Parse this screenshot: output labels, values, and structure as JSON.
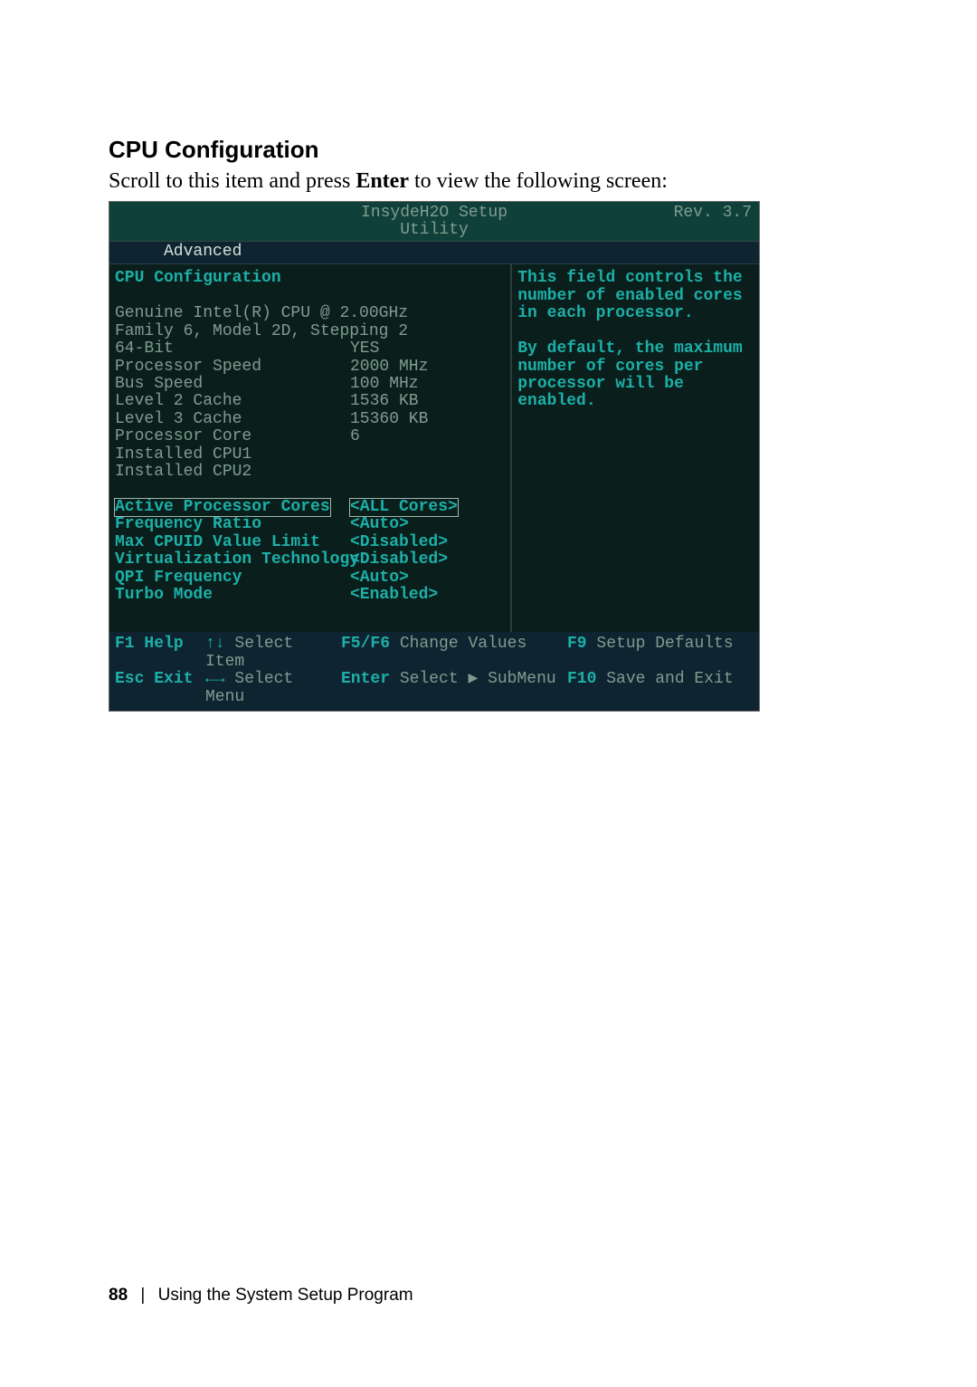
{
  "section": {
    "heading": "CPU Configuration",
    "intro_prefix": "Scroll to this item and press ",
    "intro_bold": "Enter",
    "intro_suffix": " to view the following screen:"
  },
  "bios": {
    "title": "InsydeH2O Setup Utility",
    "revision": "Rev. 3.7",
    "tab": "Advanced",
    "panel_heading": "CPU Configuration",
    "info_lines": [
      "Genuine Intel(R) CPU  @ 2.00GHz",
      "Family 6, Model 2D, Stepping 2"
    ],
    "readonly": [
      {
        "label": "64-Bit",
        "value": "YES"
      },
      {
        "label": "Processor Speed",
        "value": "2000 MHz"
      },
      {
        "label": "Bus Speed",
        "value": "100 MHz"
      },
      {
        "label": "Level 2 Cache",
        "value": "1536 KB"
      },
      {
        "label": "Level 3 Cache",
        "value": "15360 KB"
      },
      {
        "label": "Processor Core",
        "value": "6"
      },
      {
        "label": "Installed CPU1",
        "value": ""
      },
      {
        "label": "Installed CPU2",
        "value": ""
      }
    ],
    "settings": [
      {
        "label": "Active Processor Cores",
        "value": "<ALL Cores>",
        "selected": true
      },
      {
        "label": "Frequency Ratio",
        "value": "<Auto>"
      },
      {
        "label": "Max CPUID Value Limit",
        "value": "<Disabled>"
      },
      {
        "label": "Virtualization Technology",
        "value": "<Disabled>"
      },
      {
        "label": "QPI Frequency",
        "value": "<Auto>"
      },
      {
        "label": "Turbo Mode",
        "value": "<Enabled>"
      }
    ],
    "help": {
      "p1": "This field controls the number of enabled cores in each processor.",
      "p2": "By default, the maximum number of cores per processor will be enabled."
    },
    "footer": {
      "f1_key": "F1",
      "f1_label": "Help",
      "esc_key": "Esc",
      "esc_label": "Exit",
      "arrows_ud": "↑↓",
      "select_item": "Select Item",
      "arrows_lr": "←→",
      "select_menu": "Select Menu",
      "f5f6_key": "F5/F6",
      "f5f6_label": "Change Values",
      "enter_key": "Enter",
      "enter_label": "Select ▶ SubMenu",
      "f9_key": "F9",
      "f9_label": "Setup Defaults",
      "f10_key": "F10",
      "f10_label": "Save and Exit"
    }
  },
  "page_footer": {
    "page_number": "88",
    "separator": "|",
    "text": "Using the System Setup Program"
  }
}
